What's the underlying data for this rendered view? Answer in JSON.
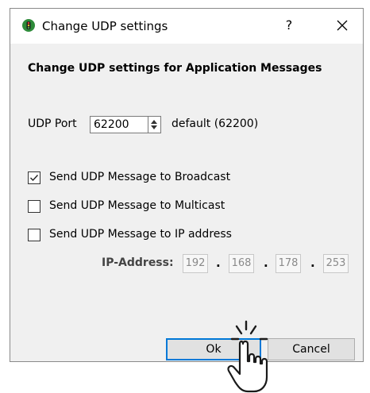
{
  "window": {
    "title": "Change UDP settings",
    "help_label": "?",
    "accent_color": "#0078d7"
  },
  "heading": "Change UDP settings for Application Messages",
  "port": {
    "label": "UDP Port",
    "value": "62200",
    "default_text": "default (62200)"
  },
  "options": [
    {
      "label": "Send UDP Message to Broadcast",
      "checked": true
    },
    {
      "label": "Send UDP Message to Multicast",
      "checked": false
    },
    {
      "label": "Send UDP Message to IP address",
      "checked": false
    }
  ],
  "ip": {
    "label": "IP-Address:",
    "octets": [
      "192",
      "168",
      "178",
      "253"
    ],
    "separator": "."
  },
  "buttons": {
    "ok": "Ok",
    "cancel": "Cancel"
  },
  "icons": {
    "app": "traffic-light-icon",
    "close": "close-icon",
    "spin": "spinbox-arrows-icon",
    "cursor": "hand-pointer-click-icon"
  }
}
